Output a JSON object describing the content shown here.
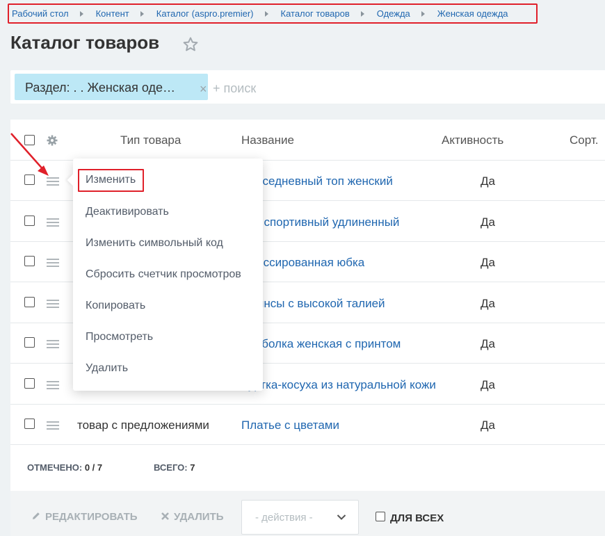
{
  "breadcrumb": [
    "Рабочий стол",
    "Контент",
    "Каталог (aspro.premier)",
    "Каталог товаров",
    "Одежда",
    "Женская одежда"
  ],
  "page_title": "Каталог товаров",
  "filter": {
    "chip_label": "Раздел: . . Женская оде…",
    "search_placeholder": "+ поиск"
  },
  "columns": {
    "type": "Тип товара",
    "name": "Название",
    "active": "Активность",
    "sort": "Сорт."
  },
  "rows": [
    {
      "type": "",
      "name": "Повседневный топ женский",
      "active": "Да"
    },
    {
      "type": "",
      "name": "Топ спортивный удлиненный",
      "active": "Да"
    },
    {
      "type": "",
      "name": "Плиссированная юбка",
      "active": "Да"
    },
    {
      "type": "",
      "name": "Джинсы с высокой талией",
      "active": "Да"
    },
    {
      "type": "",
      "name": "Футболка женская с принтом",
      "active": "Да"
    },
    {
      "type": "",
      "name": "Куртка-косуха из натуральной кожи",
      "active": "Да"
    },
    {
      "type": "товар с предложениями",
      "name": "Платье с цветами",
      "active": "Да"
    }
  ],
  "footer": {
    "selected_label": "Отмечено:",
    "selected_value": "0 / 7",
    "total_label": "Всего:",
    "total_value": "7"
  },
  "actions": {
    "edit": "Редактировать",
    "delete": "Удалить",
    "select_placeholder": "- действия -",
    "for_all": "Для всех"
  },
  "context_menu": [
    "Изменить",
    "Деактивировать",
    "Изменить символьный код",
    "Сбросить счетчик просмотров",
    "Копировать",
    "Просмотреть",
    "Удалить"
  ],
  "colors": {
    "accent_link": "#2067b0",
    "highlight_red": "#e0202a",
    "filter_chip": "#bde8f6"
  }
}
